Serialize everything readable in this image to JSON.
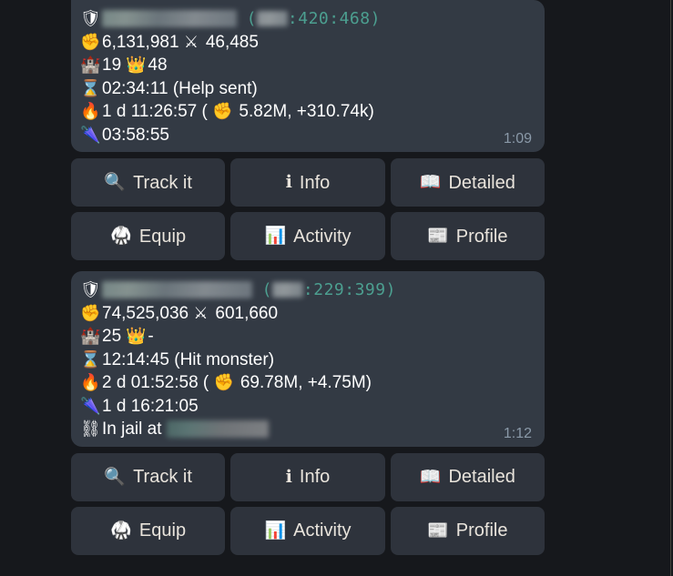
{
  "theme": {
    "page_background": "#16181c",
    "bubble_background": "#333a44",
    "button_background": "#2e333c",
    "text_color": "#ffffff",
    "coords_color": "#4c9f90",
    "timestamp_color": "#8a99a8",
    "button_label_color": "#e9e4dc"
  },
  "messages": [
    {
      "id": "message-1",
      "timestamp": "1:09",
      "lines": [
        {
          "name": "player-header-line",
          "icon": "🛡",
          "icon_name": "shield-icon",
          "player_name_redacted": true,
          "coords_open": "(",
          "coords_world_redacted": true,
          "coords_text": ":420:468",
          "coords_close": ")"
        },
        {
          "name": "might-attack-line",
          "icon": "✊",
          "icon_name": "fist-icon",
          "text": "6,131,981",
          "icon2": "⚔",
          "icon2_name": "crossed-swords-icon",
          "text2": "46,485"
        },
        {
          "name": "castle-crown-line",
          "icon": "🏰",
          "icon_name": "castle-icon",
          "text": "19",
          "icon2": "👑",
          "icon2_name": "crown-icon",
          "text2": "48"
        },
        {
          "name": "hourglass-line",
          "icon": "⌛",
          "icon_name": "hourglass-icon",
          "text": "02:34:11 (Help sent)"
        },
        {
          "name": "fire-line",
          "icon": "🔥",
          "icon_name": "fire-icon",
          "text": "1 d 11:26:57 (",
          "icon2": "✊",
          "icon2_name": "fist-icon",
          "text2": " 5.82M, +310.74k)"
        },
        {
          "name": "umbrella-line",
          "icon": "🌂",
          "icon_name": "closed-umbrella-icon",
          "text": "03:58:55"
        }
      ]
    },
    {
      "id": "message-2",
      "timestamp": "1:12",
      "lines": [
        {
          "name": "player-header-line",
          "icon": "🛡",
          "icon_name": "shield-icon",
          "player_name_redacted": true,
          "coords_open": "(",
          "coords_world_redacted": true,
          "coords_text": ":229:399",
          "coords_close": ")"
        },
        {
          "name": "might-attack-line",
          "icon": "✊",
          "icon_name": "fist-icon",
          "text": "74,525,036",
          "icon2": "⚔",
          "icon2_name": "crossed-swords-icon",
          "text2": "601,660"
        },
        {
          "name": "castle-crown-line",
          "icon": "🏰",
          "icon_name": "castle-icon",
          "text": "25",
          "icon2": "👑",
          "icon2_name": "crown-icon",
          "text2": "-"
        },
        {
          "name": "hourglass-line",
          "icon": "⌛",
          "icon_name": "hourglass-icon",
          "text": "12:14:45 (Hit monster)"
        },
        {
          "name": "fire-line",
          "icon": "🔥",
          "icon_name": "fire-icon",
          "text": "2 d 01:52:58 (",
          "icon2": "✊",
          "icon2_name": "fist-icon",
          "text2": " 69.78M, +4.75M)"
        },
        {
          "name": "umbrella-line",
          "icon": "🌂",
          "icon_name": "closed-umbrella-icon",
          "text": "1 d 16:21:05"
        },
        {
          "name": "jail-line",
          "icon": "⛓",
          "icon_name": "chains-icon",
          "text": "In jail at ",
          "jail_location_redacted": true
        }
      ]
    }
  ],
  "keyboards": [
    {
      "id": "keyboard-1",
      "buttons": [
        {
          "name": "track-it-button",
          "label": "Track it",
          "icon": "🔍",
          "icon_name": "magnifier-icon"
        },
        {
          "name": "info-button",
          "label": "Info",
          "icon": "ℹ",
          "icon_name": "information-icon"
        },
        {
          "name": "detailed-button",
          "label": "Detailed",
          "icon": "📖",
          "icon_name": "open-book-icon"
        },
        {
          "name": "equip-button",
          "label": "Equip",
          "icon": "🥋",
          "icon_name": "martial-arts-uniform-icon"
        },
        {
          "name": "activity-button",
          "label": "Activity",
          "icon": "📊",
          "icon_name": "bar-chart-icon"
        },
        {
          "name": "profile-button",
          "label": "Profile",
          "icon": "📰",
          "icon_name": "newspaper-icon"
        }
      ]
    },
    {
      "id": "keyboard-2",
      "buttons": [
        {
          "name": "track-it-button",
          "label": "Track it",
          "icon": "🔍",
          "icon_name": "magnifier-icon"
        },
        {
          "name": "info-button",
          "label": "Info",
          "icon": "ℹ",
          "icon_name": "information-icon"
        },
        {
          "name": "detailed-button",
          "label": "Detailed",
          "icon": "📖",
          "icon_name": "open-book-icon"
        },
        {
          "name": "equip-button",
          "label": "Equip",
          "icon": "🥋",
          "icon_name": "martial-arts-uniform-icon"
        },
        {
          "name": "activity-button",
          "label": "Activity",
          "icon": "📊",
          "icon_name": "bar-chart-icon"
        },
        {
          "name": "profile-button",
          "label": "Profile",
          "icon": "📰",
          "icon_name": "newspaper-icon"
        }
      ]
    }
  ]
}
